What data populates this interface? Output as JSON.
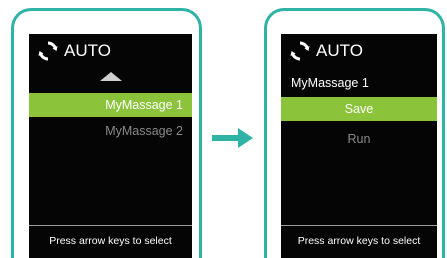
{
  "left_screen": {
    "mode_icon": "refresh-icon",
    "mode_label": "AUTO",
    "scroll_up_icon": "triangle-up-icon",
    "items": [
      {
        "label": "MyMassage 1",
        "selected": true
      },
      {
        "label": "MyMassage 2",
        "selected": false
      }
    ],
    "footer": "Press arrow keys to select"
  },
  "transition_icon": "arrow-right-icon",
  "right_screen": {
    "mode_icon": "refresh-icon",
    "mode_label": "AUTO",
    "subtitle": "MyMassage 1",
    "items": [
      {
        "label": "Save",
        "selected": true
      },
      {
        "label": "Run",
        "selected": false
      }
    ],
    "footer": "Press arrow keys to select"
  },
  "colors": {
    "frame": "#2fb3a6",
    "arrow": "#2fb3a6",
    "highlight": "#8bc43a",
    "screen_bg": "#050505",
    "dim_text": "#8a8a8a"
  }
}
